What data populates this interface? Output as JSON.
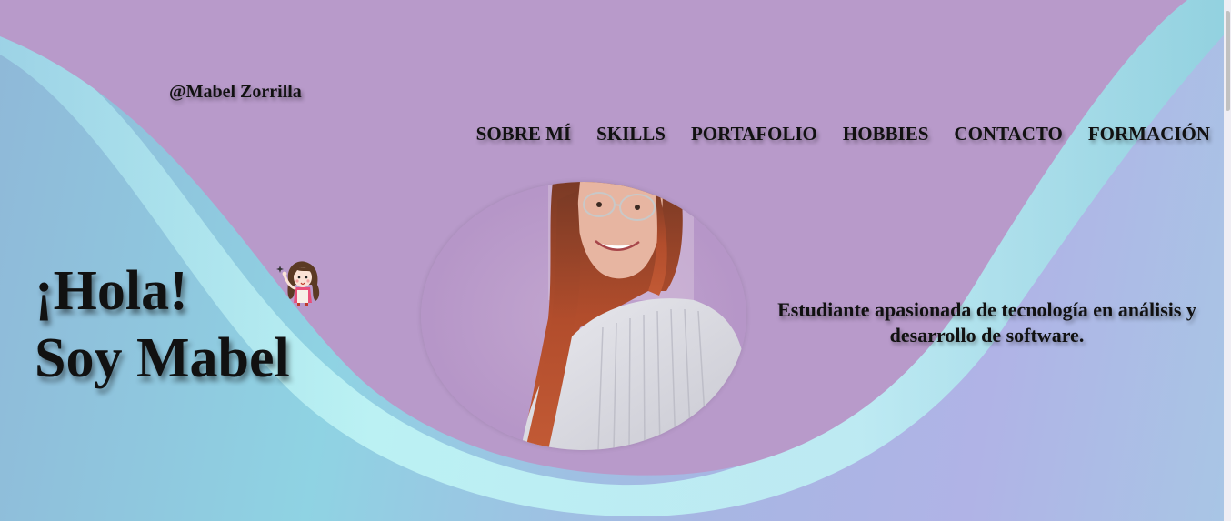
{
  "header": {
    "handle": "@Mabel Zorrilla"
  },
  "nav": {
    "items": [
      {
        "label": "SOBRE MÍ"
      },
      {
        "label": "SKILLS"
      },
      {
        "label": "PORTAFOLIO"
      },
      {
        "label": "HOBBIES"
      },
      {
        "label": "CONTACTO"
      },
      {
        "label": "FORMACIÓN"
      }
    ]
  },
  "hero": {
    "greeting": "¡Hola!",
    "name_line": "Soy Mabel",
    "tagline": "Estudiante apasionada de tecnología en análisis y desarrollo de software.",
    "avatar_icon": "girl-waving-icon",
    "photo": "profile-photo"
  },
  "colors": {
    "purple_bg": "#b89aca",
    "cyan_glow": "#b6f3f4",
    "text": "#111111"
  }
}
